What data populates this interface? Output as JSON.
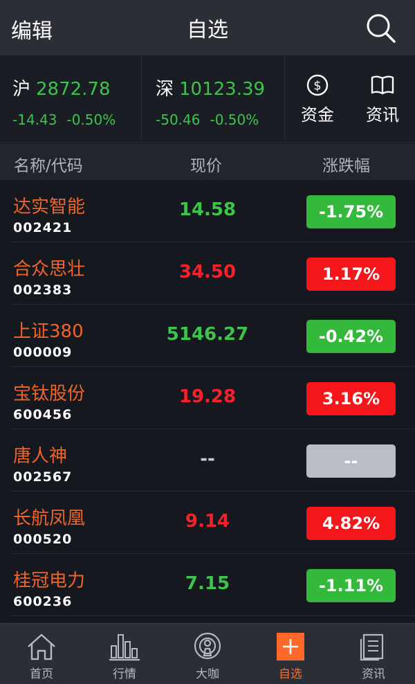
{
  "header": {
    "edit_label": "编辑",
    "title": "自选"
  },
  "indices": [
    {
      "name": "沪",
      "value": "2872.78",
      "change": "-14.43",
      "percent": "-0.50%"
    },
    {
      "name": "深",
      "value": "10123.39",
      "change": "-50.46",
      "percent": "-0.50%"
    }
  ],
  "tools": {
    "funds_label": "资金",
    "news_label": "资讯"
  },
  "columns": {
    "name": "名称/代码",
    "price": "现价",
    "change": "涨跌幅"
  },
  "stocks": [
    {
      "name": "达实智能",
      "code": "002421",
      "price": "14.58",
      "change": "-1.75%",
      "trend": "down"
    },
    {
      "name": "合众思壮",
      "code": "002383",
      "price": "34.50",
      "change": "1.17%",
      "trend": "up"
    },
    {
      "name": "上证380",
      "code": "000009",
      "price": "5146.27",
      "change": "-0.42%",
      "trend": "down"
    },
    {
      "name": "宝钛股份",
      "code": "600456",
      "price": "19.28",
      "change": "3.16%",
      "trend": "up"
    },
    {
      "name": "唐人神",
      "code": "002567",
      "price": "--",
      "change": "--",
      "trend": "flat"
    },
    {
      "name": "长航凤凰",
      "code": "000520",
      "price": "9.14",
      "change": "4.82%",
      "trend": "up"
    },
    {
      "name": "桂冠电力",
      "code": "600236",
      "price": "7.15",
      "change": "-1.11%",
      "trend": "down"
    }
  ],
  "tabs": [
    {
      "label": "首页",
      "icon": "home-icon"
    },
    {
      "label": "行情",
      "icon": "bar-chart-icon"
    },
    {
      "label": "大咖",
      "icon": "podcast-icon"
    },
    {
      "label": "自选",
      "icon": "plus-icon",
      "active": true
    },
    {
      "label": "资讯",
      "icon": "document-icon"
    }
  ],
  "colors": {
    "up": "#f5161c",
    "down": "#35b93c",
    "flat": "#b9bdc8",
    "accent": "#ff6a2a",
    "stock_name": "#f06428"
  }
}
